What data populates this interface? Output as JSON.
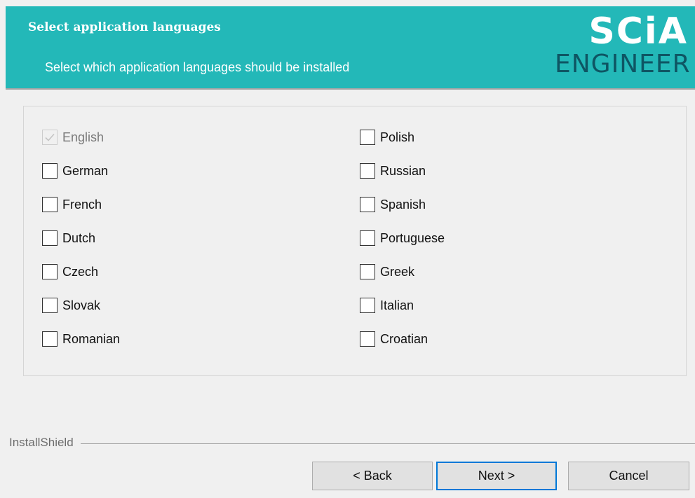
{
  "header": {
    "title": "Select application languages",
    "subtitle": "Select which application languages should be installed",
    "logo_top": "SCiA",
    "logo_bottom": "ENGINEER",
    "accent_color": "#23b8b8"
  },
  "languages": {
    "left": [
      {
        "label": "English",
        "checked": true,
        "disabled": true
      },
      {
        "label": "German",
        "checked": false,
        "disabled": false
      },
      {
        "label": "French",
        "checked": false,
        "disabled": false
      },
      {
        "label": "Dutch",
        "checked": false,
        "disabled": false
      },
      {
        "label": "Czech",
        "checked": false,
        "disabled": false
      },
      {
        "label": "Slovak",
        "checked": false,
        "disabled": false
      },
      {
        "label": "Romanian",
        "checked": false,
        "disabled": false
      }
    ],
    "right": [
      {
        "label": "Polish",
        "checked": false,
        "disabled": false
      },
      {
        "label": "Russian",
        "checked": false,
        "disabled": false
      },
      {
        "label": "Spanish",
        "checked": false,
        "disabled": false
      },
      {
        "label": "Portuguese",
        "checked": false,
        "disabled": false
      },
      {
        "label": "Greek",
        "checked": false,
        "disabled": false
      },
      {
        "label": "Italian",
        "checked": false,
        "disabled": false
      },
      {
        "label": "Croatian",
        "checked": false,
        "disabled": false
      }
    ]
  },
  "footer": {
    "brand": "InstallShield",
    "back_label": "< Back",
    "next_label": "Next >",
    "cancel_label": "Cancel"
  }
}
